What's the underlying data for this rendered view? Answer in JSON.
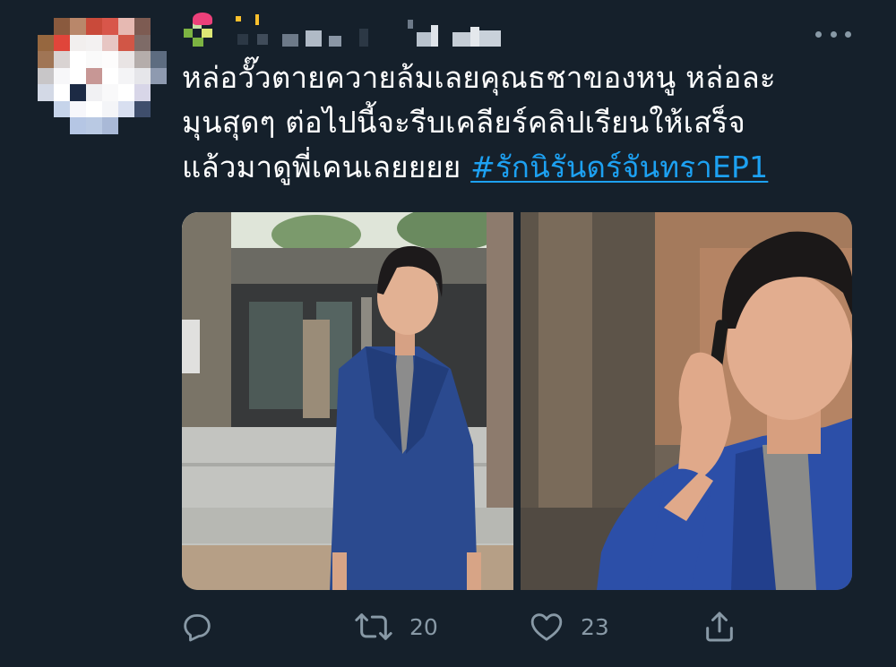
{
  "tweet": {
    "text_lines": [
      "หล่อวั๊วตายควายล้มเลยคุณธชาของหนู หล่อละ",
      "มุนสุดๆ ต่อไปนี้จะรีบเคลียร์คลิปเรียนให้เสร็จ",
      "แล้วมาดูพี่เคนเลยยยย "
    ],
    "hashtag": "#รักนิรันดร์จันทราEP1"
  },
  "media": {
    "photo_left": "photo-1",
    "photo_right": "photo-2"
  },
  "actions": {
    "reply": {
      "icon": "reply-icon",
      "count": ""
    },
    "retweet": {
      "icon": "retweet-icon",
      "count": "20"
    },
    "like": {
      "icon": "heart-icon",
      "count": "23"
    },
    "share": {
      "icon": "share-icon",
      "count": ""
    }
  },
  "colors": {
    "background": "#15202b",
    "text": "#ffffff",
    "link": "#1da1f2",
    "muted": "#8899a6"
  }
}
